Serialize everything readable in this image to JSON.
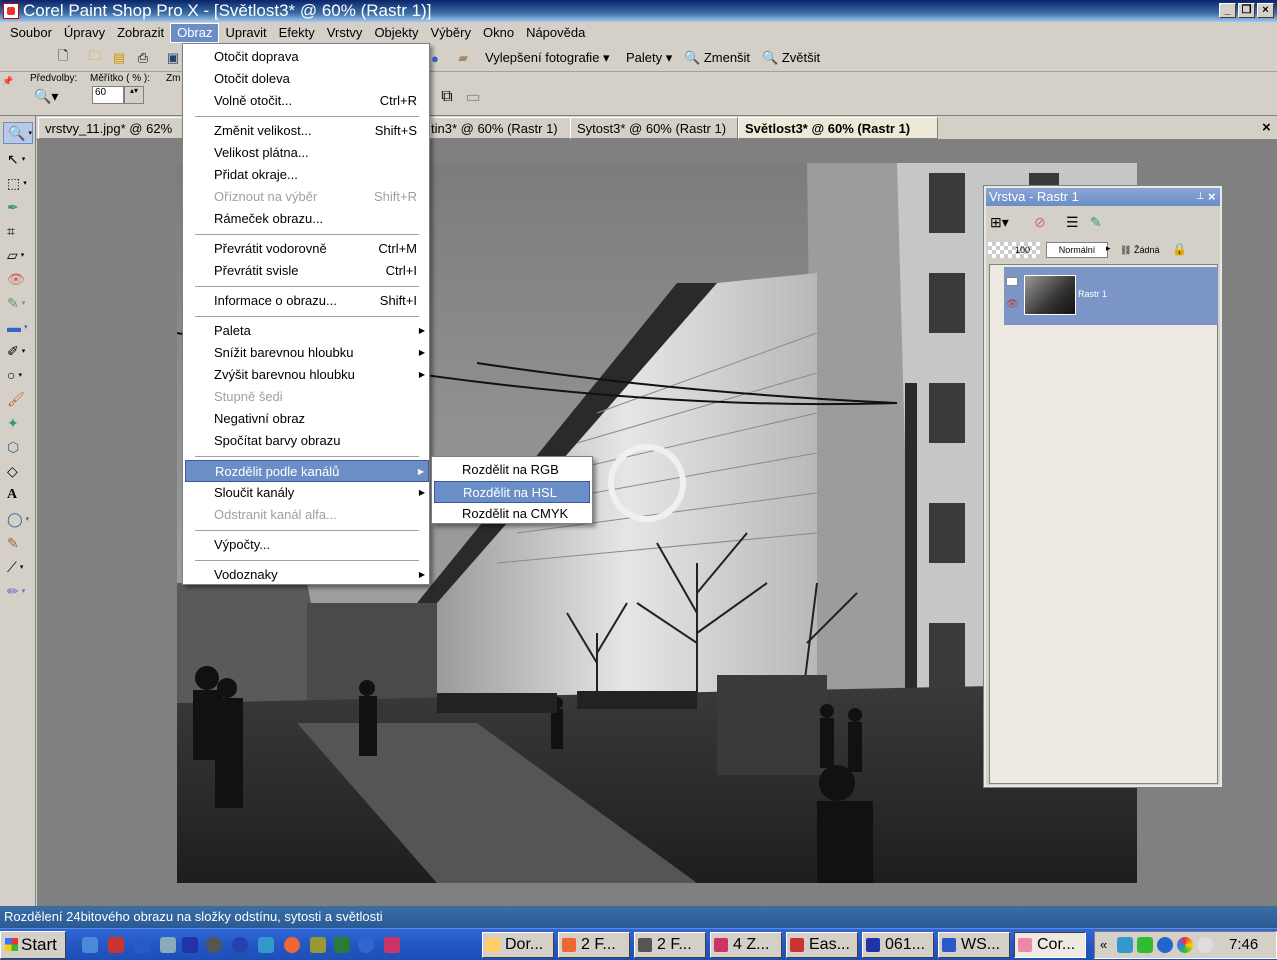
{
  "window": {
    "title": "Corel Paint Shop Pro X - [Světlost3* @  60% (Rastr 1)]"
  },
  "menubar": {
    "items": [
      "Soubor",
      "Úpravy",
      "Zobrazit",
      "Obraz",
      "Upravit",
      "Efekty",
      "Vrstvy",
      "Objekty",
      "Výběry",
      "Okno",
      "Nápověda"
    ]
  },
  "toolbar": {
    "enhance_label": "Vylepšení fotografie",
    "palettes_label": "Palety",
    "zoom_out_label": "Zmenšit",
    "zoom_in_label": "Zvětšit"
  },
  "tool_options": {
    "presets_label": "Předvolby:",
    "scale_label": "Měřítko ( % ):",
    "scale_value": "60",
    "zoom_label": "Zm"
  },
  "tabs": [
    {
      "label": "vrstvy_11.jpg* @  62%",
      "active": false
    },
    {
      "label": "tin3* @  60% (Rastr 1)",
      "active": false
    },
    {
      "label": "Sytost3* @  60% (Rastr 1)",
      "active": false
    },
    {
      "label": "Světlost3* @  60% (Rastr 1)",
      "active": true
    }
  ],
  "image_menu": {
    "items": [
      {
        "label": "Otočit doprava",
        "shortcut": "",
        "disabled": false,
        "submenu": false
      },
      {
        "label": "Otočit doleva",
        "shortcut": "",
        "disabled": false,
        "submenu": false
      },
      {
        "label": "Volně otočit...",
        "shortcut": "Ctrl+R",
        "disabled": false,
        "submenu": false
      },
      {
        "label": "Změnit velikost...",
        "shortcut": "Shift+S",
        "disabled": false,
        "submenu": false
      },
      {
        "label": "Velikost plátna...",
        "shortcut": "",
        "disabled": false,
        "submenu": false
      },
      {
        "label": "Přidat okraje...",
        "shortcut": "",
        "disabled": false,
        "submenu": false
      },
      {
        "label": "Oříznout na výběr",
        "shortcut": "Shift+R",
        "disabled": true,
        "submenu": false
      },
      {
        "label": "Rámeček obrazu...",
        "shortcut": "",
        "disabled": false,
        "submenu": false
      },
      {
        "label": "Převrátit vodorovně",
        "shortcut": "Ctrl+M",
        "disabled": false,
        "submenu": false
      },
      {
        "label": "Převrátit svisle",
        "shortcut": "Ctrl+I",
        "disabled": false,
        "submenu": false
      },
      {
        "label": "Informace o obrazu...",
        "shortcut": "Shift+I",
        "disabled": false,
        "submenu": false
      },
      {
        "label": "Paleta",
        "shortcut": "",
        "disabled": false,
        "submenu": true
      },
      {
        "label": "Snížit barevnou hloubku",
        "shortcut": "",
        "disabled": false,
        "submenu": true
      },
      {
        "label": "Zvýšit barevnou hloubku",
        "shortcut": "",
        "disabled": false,
        "submenu": true
      },
      {
        "label": "Stupně šedi",
        "shortcut": "",
        "disabled": true,
        "submenu": false
      },
      {
        "label": "Negativní obraz",
        "shortcut": "",
        "disabled": false,
        "submenu": false
      },
      {
        "label": "Spočítat barvy obrazu",
        "shortcut": "",
        "disabled": false,
        "submenu": false
      },
      {
        "label": "Rozdělit podle kanálů",
        "shortcut": "",
        "disabled": false,
        "submenu": true
      },
      {
        "label": "Sloučit kanály",
        "shortcut": "",
        "disabled": false,
        "submenu": true
      },
      {
        "label": "Odstranit kanál alfa...",
        "shortcut": "",
        "disabled": true,
        "submenu": false
      },
      {
        "label": "Výpočty...",
        "shortcut": "",
        "disabled": false,
        "submenu": false
      },
      {
        "label": "Vodoznaky",
        "shortcut": "",
        "disabled": false,
        "submenu": true
      }
    ]
  },
  "split_submenu": {
    "items": [
      "Rozdělit na RGB",
      "Rozdělit na HSL",
      "Rozdělit na CMYK"
    ]
  },
  "layers_palette": {
    "title": "Vrstva - Rastr 1",
    "opacity": "100",
    "blend_mode": "Normální",
    "mask_label": "Žádná",
    "layer_name": "Rastr 1"
  },
  "status": {
    "text": "Rozdělení 24bitového obrazu na složky odstínu, sytosti a světlosti"
  },
  "taskbar": {
    "start_label": "Start",
    "tasks": [
      "Dor...",
      "2 F...",
      "2 F...",
      "4 Z...",
      "Eas...",
      "061...",
      "WS...",
      "Cor..."
    ],
    "clock": "7:46",
    "tray_chevron": "«"
  },
  "colors": {
    "highlight": "#6b8ec6",
    "titlebar": "#0a246a",
    "taskbar": "#2457c4"
  }
}
